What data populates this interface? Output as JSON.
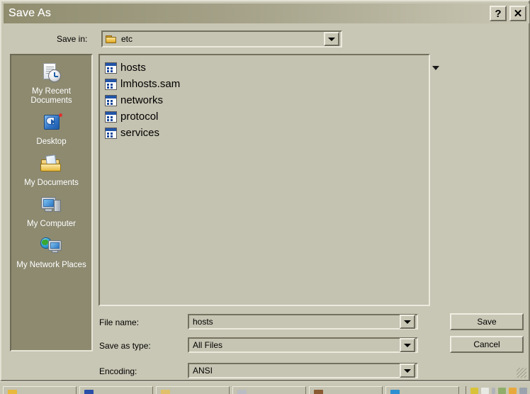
{
  "window": {
    "title": "Save As",
    "help_button": "?",
    "close_button": "✕"
  },
  "savein": {
    "label": "Save in:",
    "value": "etc",
    "folder_icon": "folder-icon",
    "dropdown_icon": "chevron-down-icon"
  },
  "toolbar": {
    "items": [
      {
        "name": "back-button",
        "icon": "back-arrow-icon",
        "enabled": false
      },
      {
        "name": "up-one-level-button",
        "icon": "folder-up-arrow-icon",
        "enabled": true
      },
      {
        "name": "create-new-folder-button",
        "icon": "new-folder-icon",
        "enabled": true
      },
      {
        "name": "views-button",
        "icon": "views-grid-icon",
        "enabled": true
      }
    ],
    "views_dropdown_icon": "chevron-down-icon"
  },
  "places": {
    "items": [
      {
        "label": "My Recent Documents",
        "icon": "recent-documents-icon"
      },
      {
        "label": "Desktop",
        "icon": "desktop-icon"
      },
      {
        "label": "My Documents",
        "icon": "my-documents-icon"
      },
      {
        "label": "My Computer",
        "icon": "my-computer-icon"
      },
      {
        "label": "My Network Places",
        "icon": "network-places-icon"
      }
    ]
  },
  "files": [
    {
      "name": "hosts",
      "icon": "generic-file-icon"
    },
    {
      "name": "lmhosts.sam",
      "icon": "generic-file-icon"
    },
    {
      "name": "networks",
      "icon": "generic-file-icon"
    },
    {
      "name": "protocol",
      "icon": "generic-file-icon"
    },
    {
      "name": "services",
      "icon": "generic-file-icon"
    }
  ],
  "form": {
    "filename_label": "File name:",
    "filename_value": "hosts",
    "filetype_label": "Save as type:",
    "filetype_value": "All Files",
    "encoding_label": "Encoding:",
    "encoding_value": "ANSI"
  },
  "buttons": {
    "save": "Save",
    "cancel": "Cancel"
  },
  "colors": {
    "dialog_face": "#c8c6b4",
    "titlebar_start": "#908d6f",
    "titlebar_end": "#c8c6b4",
    "places_bar": "#8d8a70",
    "title_text": "#ffffff",
    "field_face": "#c6c4b2"
  }
}
